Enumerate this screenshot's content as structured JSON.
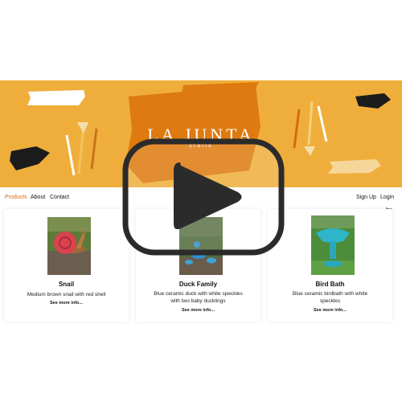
{
  "brand": {
    "name": "LA JUNTA",
    "tagline": "crafts"
  },
  "nav": {
    "left": [
      "Products",
      "About",
      "Contact"
    ],
    "right": [
      "Sign Up",
      "Login"
    ],
    "cart_icon": "cart-icon"
  },
  "products": [
    {
      "title": "Snail",
      "description": "Medium brown snail with red shell",
      "link": "See more info..."
    },
    {
      "title": "Duck Family",
      "description": "Blue ceramic duck with white speckles with two baby ducklings",
      "link": "See more info..."
    },
    {
      "title": "Bird Bath",
      "description": "Blue ceramic birdbath with white speckles",
      "link": "See more info..."
    }
  ],
  "overlay": {
    "icon": "play-button-icon"
  },
  "colors": {
    "banner": "#efae3b",
    "accent": "#d46b0a",
    "paint": "#de7a0f"
  }
}
